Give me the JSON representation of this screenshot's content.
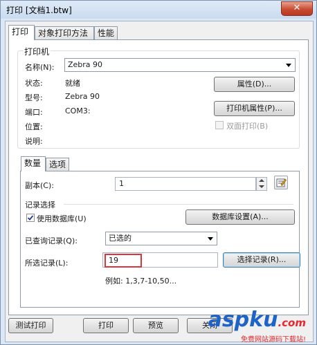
{
  "window": {
    "title": "打印 [文档1.btw]",
    "close_glyph": "✕"
  },
  "tabs": [
    "打印",
    "对象打印方法",
    "性能"
  ],
  "printer": {
    "group_label": "打印机",
    "name_label": "名称(N):",
    "name_value": "Zebra 90",
    "status_label": "状态:",
    "status_value": "就绪",
    "model_label": "型号:",
    "model_value": "Zebra 90",
    "port_label": "端口:",
    "port_value": "COM3:",
    "location_label": "位置:",
    "comment_label": "说明:",
    "properties_button": "属性(D)...",
    "printer_properties_button": "打印机属性(P)...",
    "duplex_label": "双面打印(B)"
  },
  "inner_tabs": [
    "数量",
    "选项"
  ],
  "quantity": {
    "copies_label": "副本(C):",
    "copies_value": "1",
    "record_group_label": "记录选择",
    "use_database_label": "使用数据库(U)",
    "use_database_checked": true,
    "db_settings_button": "数据库设置(A)...",
    "queried_label": "已查询记录(Q):",
    "queried_value": "已选的",
    "selected_label": "所选记录(L):",
    "selected_value": "19",
    "select_records_button": "选择记录(R)...",
    "example_text": "例如:  1,3,7-10,50..."
  },
  "footer": {
    "test_print": "测试打印",
    "print": "打印",
    "preview": "预览",
    "close": "关闭"
  },
  "watermark": {
    "brand": "aspku",
    "domain_suffix": ".com",
    "subtitle": "免费网站源码下载站!"
  },
  "colors": {
    "highlight_box": "#d9353d",
    "watermark_blue": "#1f63c7",
    "watermark_red": "#e8282e"
  }
}
